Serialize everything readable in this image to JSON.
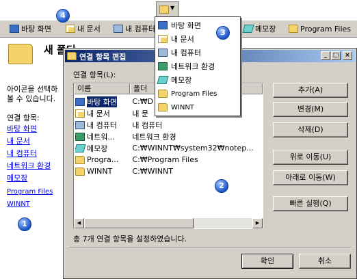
{
  "toolbar": {
    "items": [
      {
        "label": "바탕 화면",
        "icon": "desktop-icon"
      },
      {
        "label": "내 문서",
        "icon": "documents-icon"
      },
      {
        "label": "내 컴퓨터",
        "icon": "computer-icon"
      },
      {
        "label": "메모장",
        "icon": "notepad-icon"
      },
      {
        "label": "Program Files",
        "icon": "folder-icon"
      }
    ]
  },
  "left_pane": {
    "folder_title": "새 폴더",
    "desc_line1": "아이콘을 선택하",
    "desc_line2": "볼 수 있습니다.",
    "links_heading": "연결 항목:",
    "links": [
      "바탕 화면",
      "내 문서",
      "내 컴퓨터",
      "네트워크 환경",
      "메모장",
      "Program Files",
      "WINNT"
    ]
  },
  "dialog": {
    "title": "연결 항목 편집",
    "list_label": "연결 항목(L):",
    "columns": [
      "이름",
      "폴더"
    ],
    "rows": [
      {
        "name": "바탕 화면",
        "folder": "C:₩D",
        "icon": "desktop-icon",
        "selected": true
      },
      {
        "name": "내 문서",
        "folder": "내 문",
        "icon": "documents-icon"
      },
      {
        "name": "내 컴퓨터",
        "folder": "내 컴퓨터",
        "icon": "computer-icon"
      },
      {
        "name": "네트워...",
        "folder": "네트워크 환경",
        "icon": "network-icon"
      },
      {
        "name": "메모장",
        "folder": "C:₩WINNT₩system32₩notep...",
        "icon": "notepad-icon"
      },
      {
        "name": "Progra...",
        "folder": "C:₩Program Files",
        "icon": "folder-icon"
      },
      {
        "name": "WINNT",
        "folder": "C:₩WINNT",
        "icon": "folder-icon"
      }
    ],
    "status": "총 7개 연결 항목을 설정하였습니다.",
    "buttons": {
      "add": "추가(A)",
      "edit": "변경(M)",
      "delete": "삭제(D)",
      "move_up": "위로 이동(U)",
      "move_down": "아래로 이동(W)",
      "quick_run": "빠른 실행(Q)",
      "ok": "확인",
      "cancel": "취소"
    }
  },
  "menu": {
    "items": [
      {
        "label": "바탕 화면",
        "icon": "desktop-icon"
      },
      {
        "label": "내 문서",
        "icon": "documents-icon"
      },
      {
        "label": "내 컴퓨터",
        "icon": "computer-icon"
      },
      {
        "label": "네트워크 환경",
        "icon": "network-icon"
      },
      {
        "label": "메모장",
        "icon": "notepad-icon"
      },
      {
        "label": "Program Files",
        "icon": "folder-icon"
      },
      {
        "label": "WINNT",
        "icon": "folder-icon"
      }
    ]
  },
  "badges": [
    "1",
    "2",
    "3",
    "4"
  ],
  "colors": {
    "titlebar_start": "#0a246a",
    "titlebar_end": "#a6caf0",
    "face": "#d4d0c8",
    "link": "#0000ee",
    "badge": "#1c55c8"
  }
}
